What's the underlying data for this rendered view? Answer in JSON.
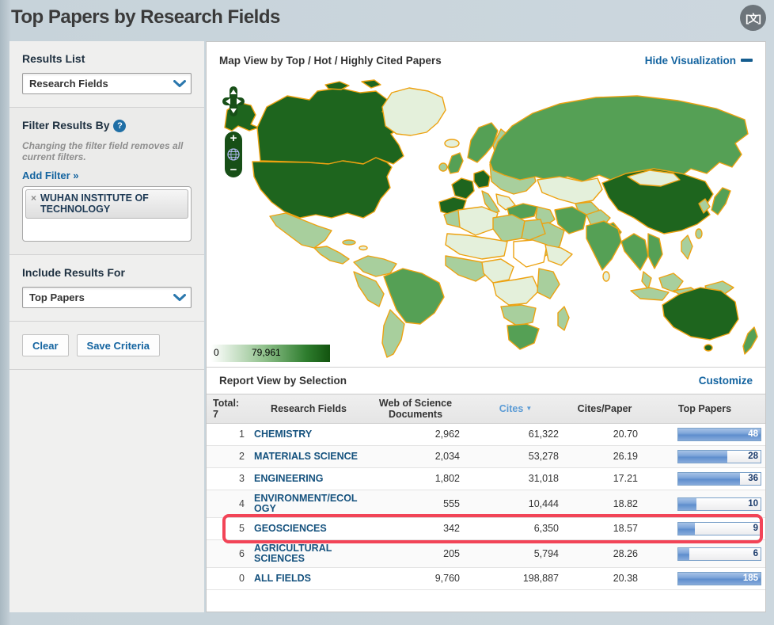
{
  "page": {
    "title": "Top Papers by Research Fields",
    "header_icon_glyph": "文"
  },
  "sidebar": {
    "results_list_label": "Results List",
    "results_list_value": "Research Fields",
    "filter_label": "Filter Results By",
    "filter_help": "?",
    "filter_note": "Changing the filter field removes all current filters.",
    "add_filter_label": "Add Filter »",
    "filter_tag_remove": "×",
    "filter_tag": "WUHAN INSTITUTE OF TECHNOLOGY",
    "include_label": "Include Results For",
    "include_value": "Top Papers",
    "clear_label": "Clear",
    "save_label": "Save Criteria"
  },
  "map": {
    "title": "Map View by Top / Hot / Highly Cited Papers",
    "hide_label": "Hide Visualization",
    "legend_min": "0",
    "legend_max": "79,961",
    "color_min": "#ffffff",
    "color_max": "#13540f",
    "border_color": "#eda211"
  },
  "report": {
    "title": "Report View by Selection",
    "customize_label": "Customize",
    "columns": {
      "total_line1": "Total:",
      "total_line2": "7",
      "fields": "Research Fields",
      "docs": "Web of Science Documents",
      "cites": "Cites",
      "cites_sort": "▼",
      "cpp": "Cites/Paper",
      "top": "Top Papers"
    },
    "rows": [
      {
        "rank": "1",
        "field": "CHEMISTRY",
        "docs": "2,962",
        "cites": "61,322",
        "cpp": "20.70",
        "top_papers": "48",
        "bar_pct": 100,
        "highlighted": false
      },
      {
        "rank": "2",
        "field": "MATERIALS SCIENCE",
        "docs": "2,034",
        "cites": "53,278",
        "cpp": "26.19",
        "top_papers": "28",
        "bar_pct": 60,
        "highlighted": false
      },
      {
        "rank": "3",
        "field": "ENGINEERING",
        "docs": "1,802",
        "cites": "31,018",
        "cpp": "17.21",
        "top_papers": "36",
        "bar_pct": 75,
        "highlighted": false
      },
      {
        "rank": "4",
        "field": "ENVIRONMENT/ECOLOGY",
        "docs": "555",
        "cites": "10,444",
        "cpp": "18.82",
        "top_papers": "10",
        "bar_pct": 22,
        "highlighted": false
      },
      {
        "rank": "5",
        "field": "GEOSCIENCES",
        "docs": "342",
        "cites": "6,350",
        "cpp": "18.57",
        "top_papers": "9",
        "bar_pct": 20,
        "highlighted": true
      },
      {
        "rank": "6",
        "field": "AGRICULTURAL SCIENCES",
        "docs": "205",
        "cites": "5,794",
        "cpp": "28.26",
        "top_papers": "6",
        "bar_pct": 13,
        "highlighted": false
      },
      {
        "rank": "0",
        "field": "ALL FIELDS",
        "docs": "9,760",
        "cites": "198,887",
        "cpp": "20.38",
        "top_papers": "185",
        "bar_pct": 100,
        "highlighted": false
      }
    ]
  }
}
